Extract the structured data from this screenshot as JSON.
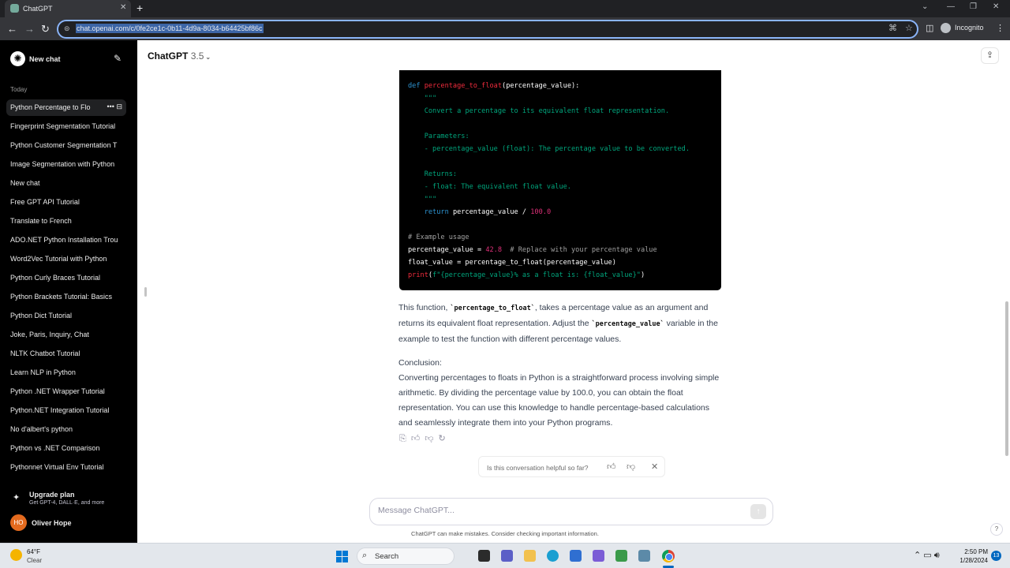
{
  "browser": {
    "tab_title": "ChatGPT",
    "url": "chat.openai.com/c/0fe2ce1c-0b11-4d9a-8034-b64425bf86c",
    "profile_label": "Incognito"
  },
  "sidebar": {
    "new_chat_label": "New chat",
    "section_label": "Today",
    "history": [
      "Python Percentage to Flo",
      "Fingerprint Segmentation Tutorial",
      "Python Customer Segmentation T",
      "Image Segmentation with Python",
      "New chat",
      "Free GPT API Tutorial",
      "Translate to French",
      "ADO.NET Python Installation Trou",
      "Word2Vec Tutorial with Python",
      "Python Curly Braces Tutorial",
      "Python Brackets Tutorial: Basics",
      "Python Dict Tutorial",
      "Joke, Paris, Inquiry, Chat",
      "NLTK Chatbot Tutorial",
      "Learn NLP in Python",
      "Python .NET Wrapper Tutorial",
      "Python.NET Integration Tutorial",
      "No d'albert's python",
      "Python vs .NET Comparison",
      "Pythonnet Virtual Env Tutorial"
    ],
    "upgrade_title": "Upgrade plan",
    "upgrade_sub": "Get GPT-4, DALL·E, and more",
    "user_initials": "HO",
    "user_name": "Oliver Hope"
  },
  "header": {
    "model": "ChatGPT",
    "version": "3.5"
  },
  "code": {
    "def_kw": "def",
    "fn_name": "percentage_to_float",
    "def_rest": "(percentage_value):",
    "doc_open": "\"\"\"",
    "doc1": "Convert a percentage to its equivalent float representation.",
    "doc2": "Parameters:",
    "doc3": "- percentage_value (float): The percentage value to be converted.",
    "doc4": "Returns:",
    "doc5": "- float: The equivalent float value.",
    "doc_close": "\"\"\"",
    "ret_kw": "return",
    "ret_expr": "percentage_value / ",
    "ret_num": "100.0",
    "comment1": "# Example usage",
    "assign_lhs": "percentage_value = ",
    "assign_num": "42.8",
    "assign_comment": "# Replace with your percentage value",
    "call_line": "float_value = percentage_to_float(percentage_value)",
    "print_fn": "print",
    "print_open": "(",
    "print_str": "f\"{percentage_value}% as a float is: {float_value}\"",
    "print_close": ")"
  },
  "response": {
    "p1_a": "This function, ",
    "p1_code1": "`percentage_to_float`",
    "p1_b": ", takes a percentage value as an argument and returns its equivalent float representation. Adjust the ",
    "p1_code2": "`percentage_value`",
    "p1_c": " variable in the example to test the function with different percentage values.",
    "conclusion_title": "Conclusion:",
    "conclusion_body": "Converting percentages to floats in Python is a straightforward process involving simple arithmetic. By dividing the percentage value by 100.0, you can obtain the float representation. You can use this knowledge to handle percentage-based calculations and seamlessly integrate them into your Python programs."
  },
  "feedback": {
    "question": "Is this conversation helpful so far?"
  },
  "composer": {
    "placeholder": "Message ChatGPT..."
  },
  "disclaimer": "ChatGPT can make mistakes. Consider checking important information.",
  "taskbar": {
    "temp": "64°F",
    "condition": "Clear",
    "search_label": "Search",
    "time": "2:50 PM",
    "date": "1/28/2024",
    "notif_count": "13"
  }
}
